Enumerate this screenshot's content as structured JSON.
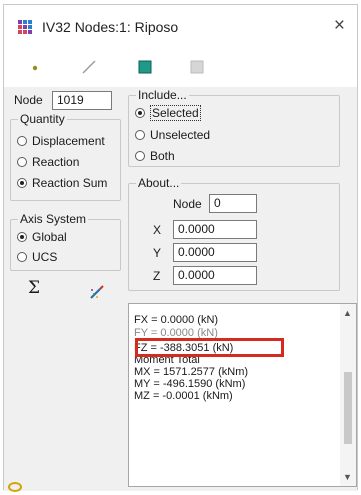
{
  "window": {
    "title": "IV32 Nodes:1: Riposo",
    "close_glyph": "×"
  },
  "toolbar": {
    "items": [
      {
        "name": "node-point-tool",
        "icon": "dot-icon"
      },
      {
        "name": "line-tool",
        "icon": "pencil-line-icon"
      },
      {
        "name": "surface-tool",
        "icon": "teal-square-icon"
      },
      {
        "name": "disabled-tool",
        "icon": "grey-square-icon"
      }
    ]
  },
  "node": {
    "label": "Node",
    "value": "1019"
  },
  "quantity": {
    "label": "Quantity",
    "options": [
      {
        "label": "Displacement",
        "selected": false
      },
      {
        "label": "Reaction",
        "selected": false
      },
      {
        "label": "Reaction Sum",
        "selected": true
      }
    ]
  },
  "axis_system": {
    "label": "Axis System",
    "options": [
      {
        "label": "Global",
        "selected": true
      },
      {
        "label": "UCS",
        "selected": false
      }
    ]
  },
  "include": {
    "label": "Include...",
    "options": [
      {
        "label": "Selected",
        "selected": true
      },
      {
        "label": "Unselected",
        "selected": false
      },
      {
        "label": "Both",
        "selected": false
      }
    ]
  },
  "about": {
    "label": "About...",
    "node_label": "Node",
    "node_value": "0",
    "x_label": "X",
    "x_value": "0.0000",
    "y_label": "Y",
    "y_value": "0.0000",
    "z_label": "Z",
    "z_value": "0.0000"
  },
  "icons": {
    "sum_glyph": "Σ"
  },
  "results": {
    "lines": [
      "FX  = 0.0000 (kN)",
      "FY  = 0.0000 (kN)",
      "FZ  = -388.3051 (kN)",
      "Moment Total",
      "MX  = 1571.2577 (kNm)",
      "MY  = -496.1590 (kNm)",
      "MZ  = -0.0001 (kNm)"
    ]
  },
  "colors": {
    "highlight": "#d42a20",
    "accent_teal": "#1f9a8a"
  }
}
